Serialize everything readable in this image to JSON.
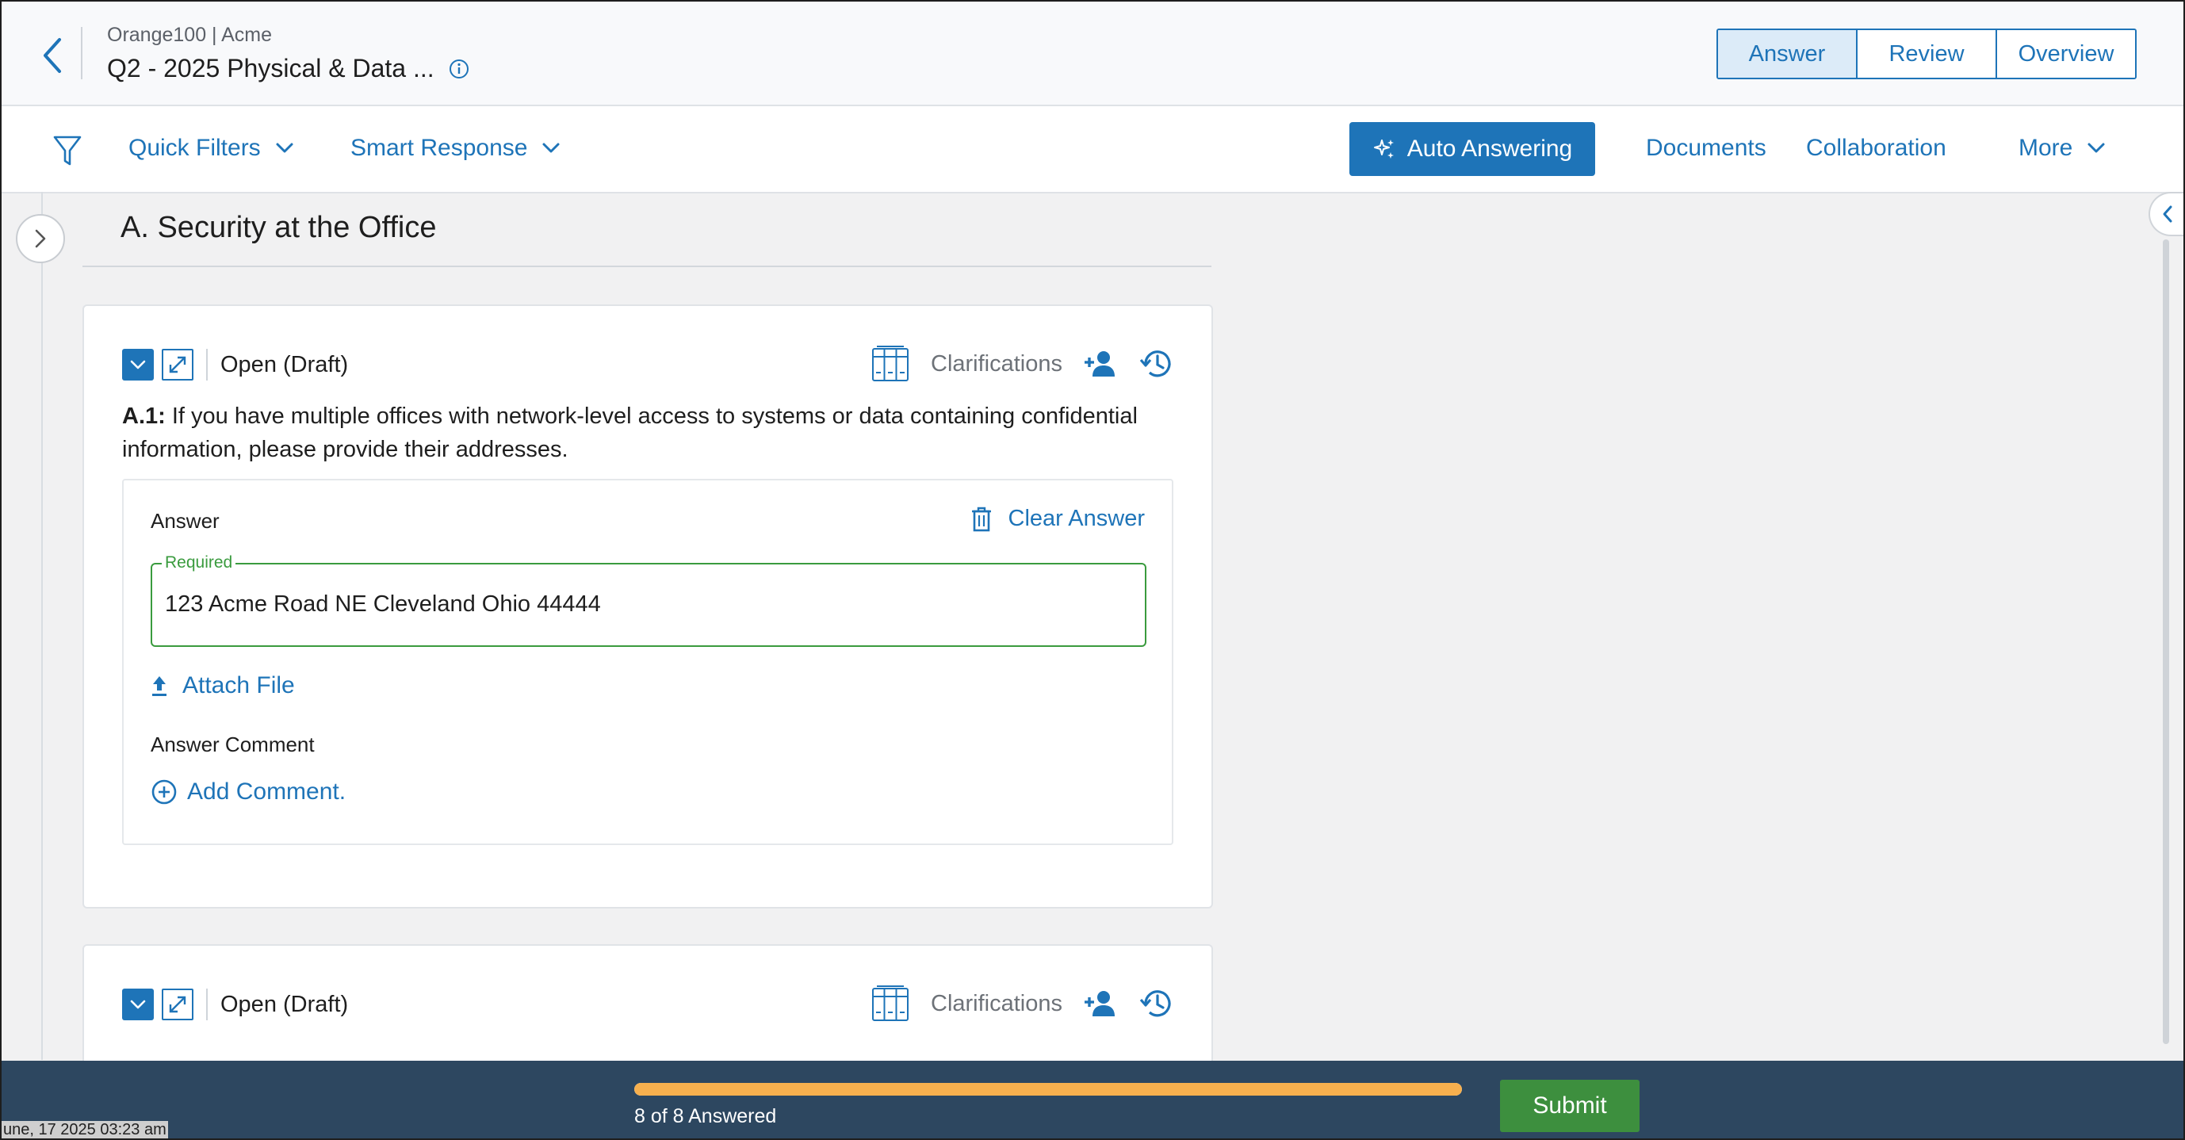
{
  "header": {
    "breadcrumb": "Orange100 | Acme",
    "title": "Q2 - 2025 Physical & Data ...",
    "modes": [
      {
        "label": "Answer",
        "active": true
      },
      {
        "label": "Review",
        "active": false
      },
      {
        "label": "Overview",
        "active": false
      }
    ]
  },
  "toolbar": {
    "quick_filters": "Quick Filters",
    "smart_response": "Smart Response",
    "auto_answering": "Auto Answering",
    "documents": "Documents",
    "collaboration": "Collaboration",
    "more": "More"
  },
  "section": {
    "title": "A. Security at the Office"
  },
  "questions": [
    {
      "status": "Open (Draft)",
      "clarifications": "Clarifications",
      "number": "A.1:",
      "text": "If you have multiple offices with network-level access to systems or data containing confidential information, please provide their addresses.",
      "answer_label": "Answer",
      "clear_answer": "Clear Answer",
      "required_legend": "Required",
      "answer_value": "123 Acme Road NE Cleveland Ohio 44444",
      "attach_file": "Attach File",
      "comment_label": "Answer Comment",
      "add_comment": "Add Comment."
    },
    {
      "status": "Open (Draft)",
      "clarifications": "Clarifications"
    }
  ],
  "footer": {
    "progress_text": "8 of 8 Answered",
    "progress_fraction": 1.0,
    "submit": "Submit",
    "timestamp": "une, 17 2025 03:23 am"
  },
  "colors": {
    "accent": "#1e74b8",
    "success": "#3d8f3e",
    "progress": "#f7b04e",
    "footer_bg": "#2d4760"
  },
  "icons": [
    "back-arrow-icon",
    "info-icon",
    "filter-icon",
    "chevron-down-icon",
    "sparkle-icon",
    "chevron-right-icon",
    "chevron-left-icon",
    "checkbox-icon",
    "expand-icon",
    "binder-icon",
    "add-user-icon",
    "history-icon",
    "trash-icon",
    "upload-icon",
    "plus-circle-icon"
  ]
}
